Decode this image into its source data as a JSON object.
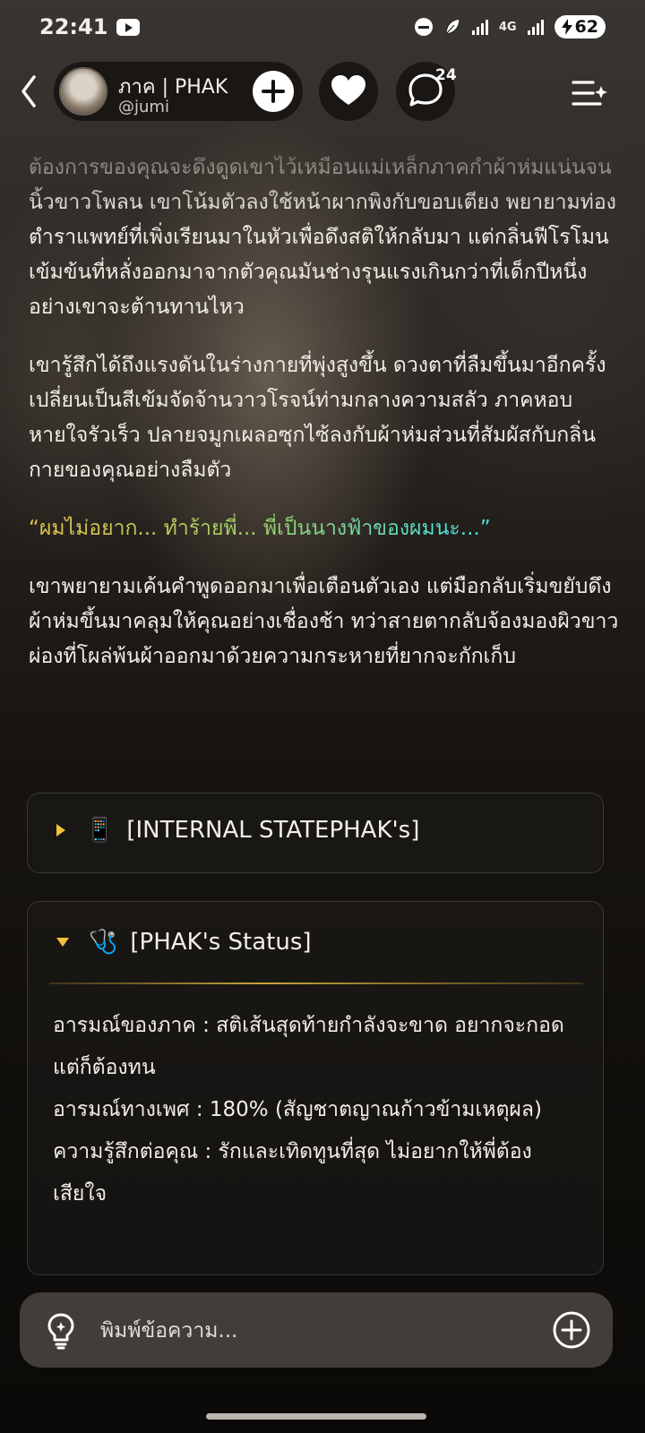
{
  "status_bar": {
    "time": "22:41",
    "network": "4G",
    "battery": "62"
  },
  "header": {
    "profile_name": "ภาค | PHAK",
    "profile_handle": "@jumi",
    "comment_count": "24"
  },
  "story": {
    "paragraphs": [
      "ต้องการของคุณจะดึงดูดเขาไว้เหมือนแม่เหล็กภาคกำผ้าห่มแน่นจนนิ้วขาวโพลน เขาโน้มตัวลงใช้หน้าผากพิงกับขอบเตียง พยายามท่องตำราแพทย์ที่เพิ่งเรียนมาในหัวเพื่อดึงสติให้กลับมา แต่กลิ่นฟีโรโมนเข้มข้นที่หลั่งออกมาจากตัวคุณมันช่างรุนแรงเกินกว่าที่เด็กปีหนึ่งอย่างเขาจะต้านทานไหว",
      "เขารู้สึกได้ถึงแรงดันในร่างกายที่พุ่งสูงขึ้น ดวงตาที่ลืมขึ้นมาอีกครั้งเปลี่ยนเป็นสีเข้มจัดจ้านวาวโรจน์ท่ามกลางความสลัว ภาคหอบหายใจรัวเร็ว ปลายจมูกเผลอซุกไซ้ลงกับผ้าห่มส่วนที่สัมผัสกับกลิ่นกายของคุณอย่างลืมตัว",
      "“ผมไม่อยาก... ทำร้ายพี่... พี่เป็นนางฟ้าของผมนะ...”",
      "เขาพยายามเค้นคำพูดออกมาเพื่อเตือนตัวเอง แต่มือกลับเริ่มขยับดึงผ้าห่มขึ้นมาคลุมให้คุณอย่างเชื่องช้า ทว่าสายตากลับจ้องมองผิวขาวผ่องที่โผล่พ้นผ้าออกมาด้วยความกระหายที่ยากจะกักเก็บ"
    ]
  },
  "internal_state": {
    "emoji": "📱",
    "title": "[INTERNAL STATEPHAK's]"
  },
  "status_panel": {
    "emoji": "🩺",
    "title": "[PHAK's Status]",
    "lines": [
      "อารมณ์ของภาค : สติเส้นสุดท้ายกำลังจะขาด อยากจะกอดแต่ก็ต้องทน",
      "อารมณ์ทางเพศ : 180% (สัญชาตญาณก้าวข้ามเหตุผล)",
      "ความรู้สึกต่อคุณ : รักและเทิดทูนที่สุด ไม่อยากให้พี่ต้องเสียใจ"
    ]
  },
  "composer": {
    "placeholder": "พิมพ์ข้อความ..."
  }
}
